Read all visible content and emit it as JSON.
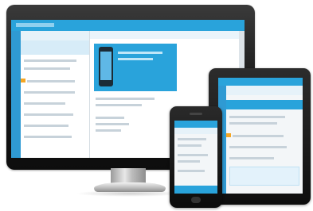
{
  "scene": {
    "devices": [
      "monitor",
      "tablet",
      "phone"
    ]
  },
  "colors": {
    "accent": "#29a3db",
    "accent_dark": "#1a86bf",
    "sidebar": "#2f9ad3",
    "highlight": "#f5a623",
    "screen_bg": "#f3f6f8",
    "placeholder_text": "#c7d2da"
  }
}
